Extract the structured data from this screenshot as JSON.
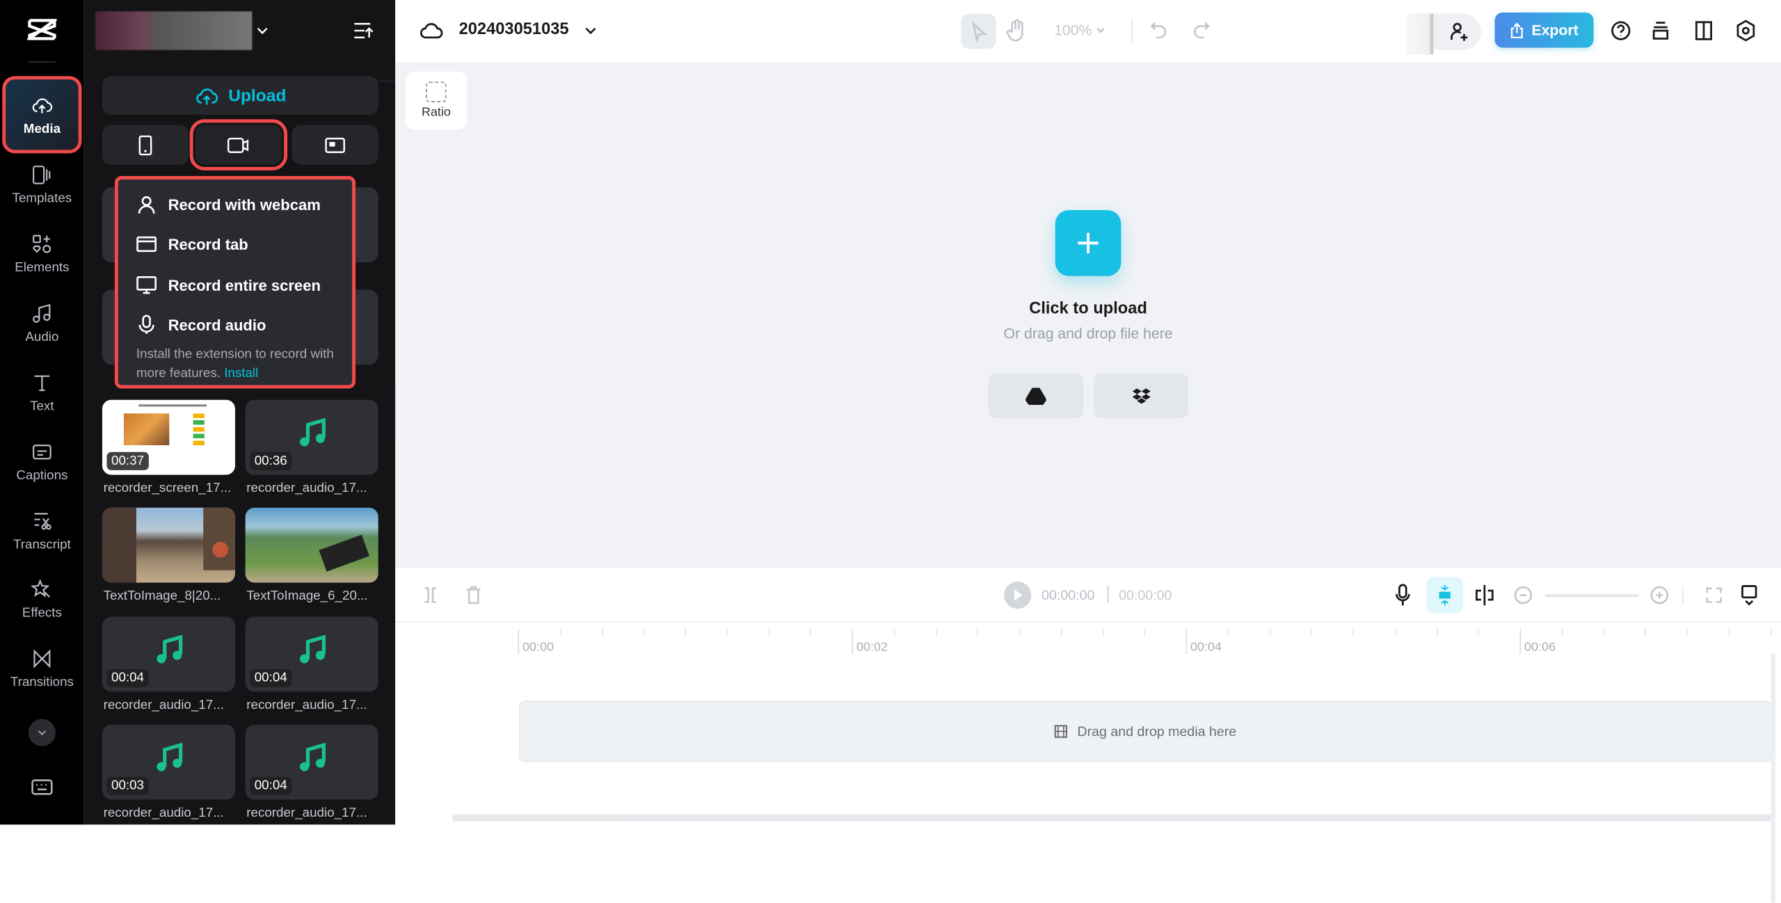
{
  "app": {
    "logo": "capcut-logo"
  },
  "rail": {
    "items": [
      {
        "label": "Media",
        "icon": "cloud-upload-icon",
        "active": true
      },
      {
        "label": "Templates",
        "icon": "templates-icon"
      },
      {
        "label": "Elements",
        "icon": "elements-icon"
      },
      {
        "label": "Audio",
        "icon": "music-icon"
      },
      {
        "label": "Text",
        "icon": "text-icon"
      },
      {
        "label": "Captions",
        "icon": "captions-icon"
      },
      {
        "label": "Transcript",
        "icon": "transcript-icon"
      },
      {
        "label": "Effects",
        "icon": "effects-icon"
      },
      {
        "label": "Transitions",
        "icon": "transitions-icon"
      }
    ]
  },
  "panel": {
    "upload_label": "Upload",
    "record_menu": {
      "items": [
        "Record with webcam",
        "Record tab",
        "Record entire screen",
        "Record audio"
      ],
      "note": "Install the extension to record with more features.",
      "install_link": "Install"
    },
    "media": [
      {
        "duration": "00:37",
        "name": "recorder_screen_17...",
        "type": "screen"
      },
      {
        "duration": "00:36",
        "name": "recorder_audio_17...",
        "type": "audio"
      },
      {
        "duration": "",
        "name": "TextToImage_8|20...",
        "type": "image-street"
      },
      {
        "duration": "",
        "name": "TextToImage_6_20...",
        "type": "image-valley"
      },
      {
        "duration": "00:04",
        "name": "recorder_audio_17...",
        "type": "audio"
      },
      {
        "duration": "00:04",
        "name": "recorder_audio_17...",
        "type": "audio"
      },
      {
        "duration": "00:03",
        "name": "recorder_audio_17...",
        "type": "audio"
      },
      {
        "duration": "00:04",
        "name": "recorder_audio_17...",
        "type": "audio"
      }
    ]
  },
  "header": {
    "project_name": "202403051035",
    "zoom": "100%",
    "export_label": "Export"
  },
  "canvas": {
    "ratio_label": "Ratio",
    "upload_title": "Click to upload",
    "upload_sub": "Or drag and drop file here"
  },
  "timeline": {
    "current_time": "00:00:00",
    "total_time": "00:00:00",
    "ruler": [
      "00:00",
      "00:02",
      "00:04",
      "00:06"
    ],
    "drop_hint": "Drag and drop media here"
  },
  "colors": {
    "accent": "#00c2e0",
    "highlight": "#f04a4a",
    "audio": "#1bc08f",
    "export_start": "#4a8ce8",
    "export_end": "#2ab8e0"
  }
}
